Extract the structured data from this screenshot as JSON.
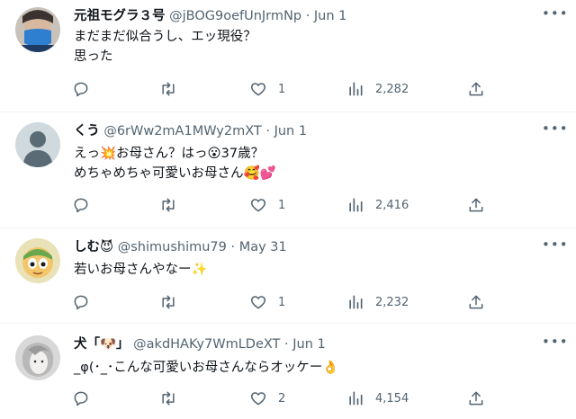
{
  "tweets": [
    {
      "name": "元祖モグラ３号",
      "handle": "@jBOG9oefUnJrmNp",
      "separator": "·",
      "date": "Jun 1",
      "text": "まだまだ似合うし、エッ現役？\n思った",
      "replies": "",
      "retweets": "",
      "likes": "1",
      "views": "2,282"
    },
    {
      "name": "くう",
      "handle": "@6rWw2mA1MWy2mXT",
      "separator": "·",
      "date": "Jun 1",
      "text": "えっ💥お母さん？はっ😮37歳？\nめちゃめちゃ可愛いお母さん🥰💕",
      "replies": "",
      "retweets": "",
      "likes": "1",
      "views": "2,416"
    },
    {
      "name": "しむ😈",
      "handle": "@shimushimu79",
      "separator": "·",
      "date": "May 31",
      "text": "若いお母さんやなー✨",
      "replies": "",
      "retweets": "",
      "likes": "1",
      "views": "2,232"
    },
    {
      "name": "犬「🐶」",
      "handle": "@akdHAKy7WmLDeXT",
      "separator": "·",
      "date": "Jun 1",
      "text": "_φ(･_･こんな可愛いお母さんならオッケー👌",
      "replies": "",
      "retweets": "",
      "likes": "2",
      "views": "4,154"
    }
  ],
  "icons": {
    "more": "more-horizontal-icon",
    "reply": "reply-icon",
    "retweet": "retweet-icon",
    "like": "heart-icon",
    "views": "views-chart-icon",
    "share": "share-icon"
  },
  "colors": {
    "text": "#0f1419",
    "secondary": "#536471",
    "divider": "#eff3f4"
  }
}
